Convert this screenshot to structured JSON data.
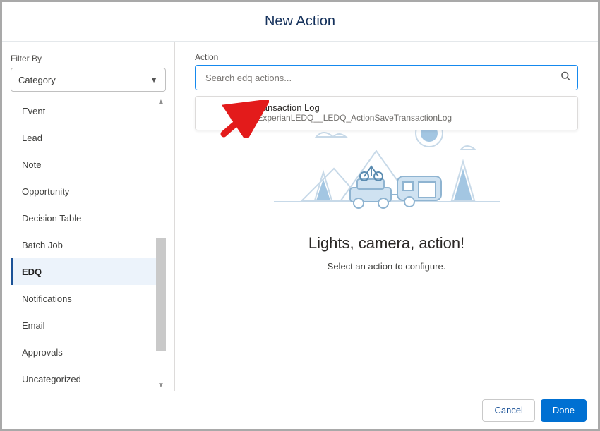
{
  "header": {
    "title": "New Action"
  },
  "sidebar": {
    "filter_label": "Filter By",
    "select_value": "Category",
    "items": [
      {
        "label": "Event",
        "selected": false
      },
      {
        "label": "Lead",
        "selected": false
      },
      {
        "label": "Note",
        "selected": false
      },
      {
        "label": "Opportunity",
        "selected": false
      },
      {
        "label": "Decision Table",
        "selected": false
      },
      {
        "label": "Batch Job",
        "selected": false
      },
      {
        "label": "EDQ",
        "selected": true
      },
      {
        "label": "Notifications",
        "selected": false
      },
      {
        "label": "Email",
        "selected": false
      },
      {
        "label": "Approvals",
        "selected": false
      },
      {
        "label": "Uncategorized",
        "selected": false
      }
    ]
  },
  "main": {
    "action_label": "Action",
    "search_placeholder": "Search edq actions...",
    "headline": "Lights, camera, action!",
    "subline": "Select an action to configure."
  },
  "dropdown": {
    "items": [
      {
        "title": "Save Transaction Log",
        "subtitle": "apex-TExperianLEDQ__LEDQ_ActionSaveTransactionLog"
      }
    ]
  },
  "footer": {
    "cancel": "Cancel",
    "done": "Done"
  }
}
